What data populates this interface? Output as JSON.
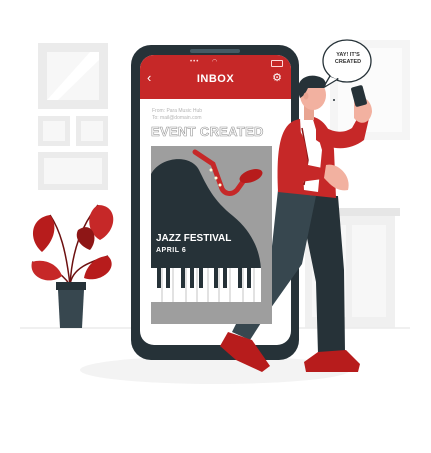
{
  "app": {
    "header_title": "INBOX",
    "back_icon": "chevron-left-icon",
    "settings_icon": "gear-icon"
  },
  "email": {
    "from_line": "From: Para Music Hub",
    "to_line": "To: mail@domain.com",
    "heading": "EVENT CREATED"
  },
  "poster": {
    "title": "JAZZ FESTIVAL",
    "date": "APRIL  6"
  },
  "speech_bubble": {
    "line1": "YAY! IT'S",
    "line2": "CREATED"
  },
  "colors": {
    "accent": "#c62828",
    "dark": "#263238",
    "poster_bg": "#9e9e9e",
    "wall_frame": "#e9e9e9"
  }
}
